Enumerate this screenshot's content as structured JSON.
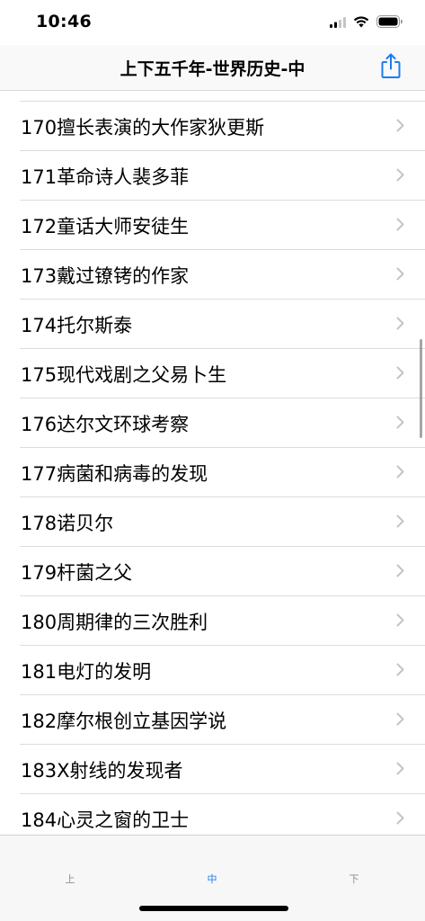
{
  "status_bar": {
    "time": "10:46"
  },
  "nav": {
    "title": "上下五千年-世界历史-中",
    "share_icon": "share-icon",
    "accent": "#1a7cf5"
  },
  "list": {
    "items": [
      {
        "label": "170擅长表演的大作家狄更斯"
      },
      {
        "label": "171革命诗人裴多菲"
      },
      {
        "label": "172童话大师安徒生"
      },
      {
        "label": "173戴过镣铐的作家"
      },
      {
        "label": "174托尔斯泰"
      },
      {
        "label": "175现代戏剧之父易卜生"
      },
      {
        "label": "176达尔文环球考察"
      },
      {
        "label": "177病菌和病毒的发现"
      },
      {
        "label": "178诺贝尔"
      },
      {
        "label": "179杆菌之父"
      },
      {
        "label": "180周期律的三次胜利"
      },
      {
        "label": "181电灯的发明"
      },
      {
        "label": "182摩尔根创立基因学说"
      },
      {
        "label": "183X射线的发现者"
      },
      {
        "label": "184心灵之窗的卫士"
      }
    ]
  },
  "tab_bar": {
    "tabs": [
      {
        "label": "上",
        "active": false
      },
      {
        "label": "中",
        "active": true
      },
      {
        "label": "下",
        "active": false
      }
    ]
  }
}
